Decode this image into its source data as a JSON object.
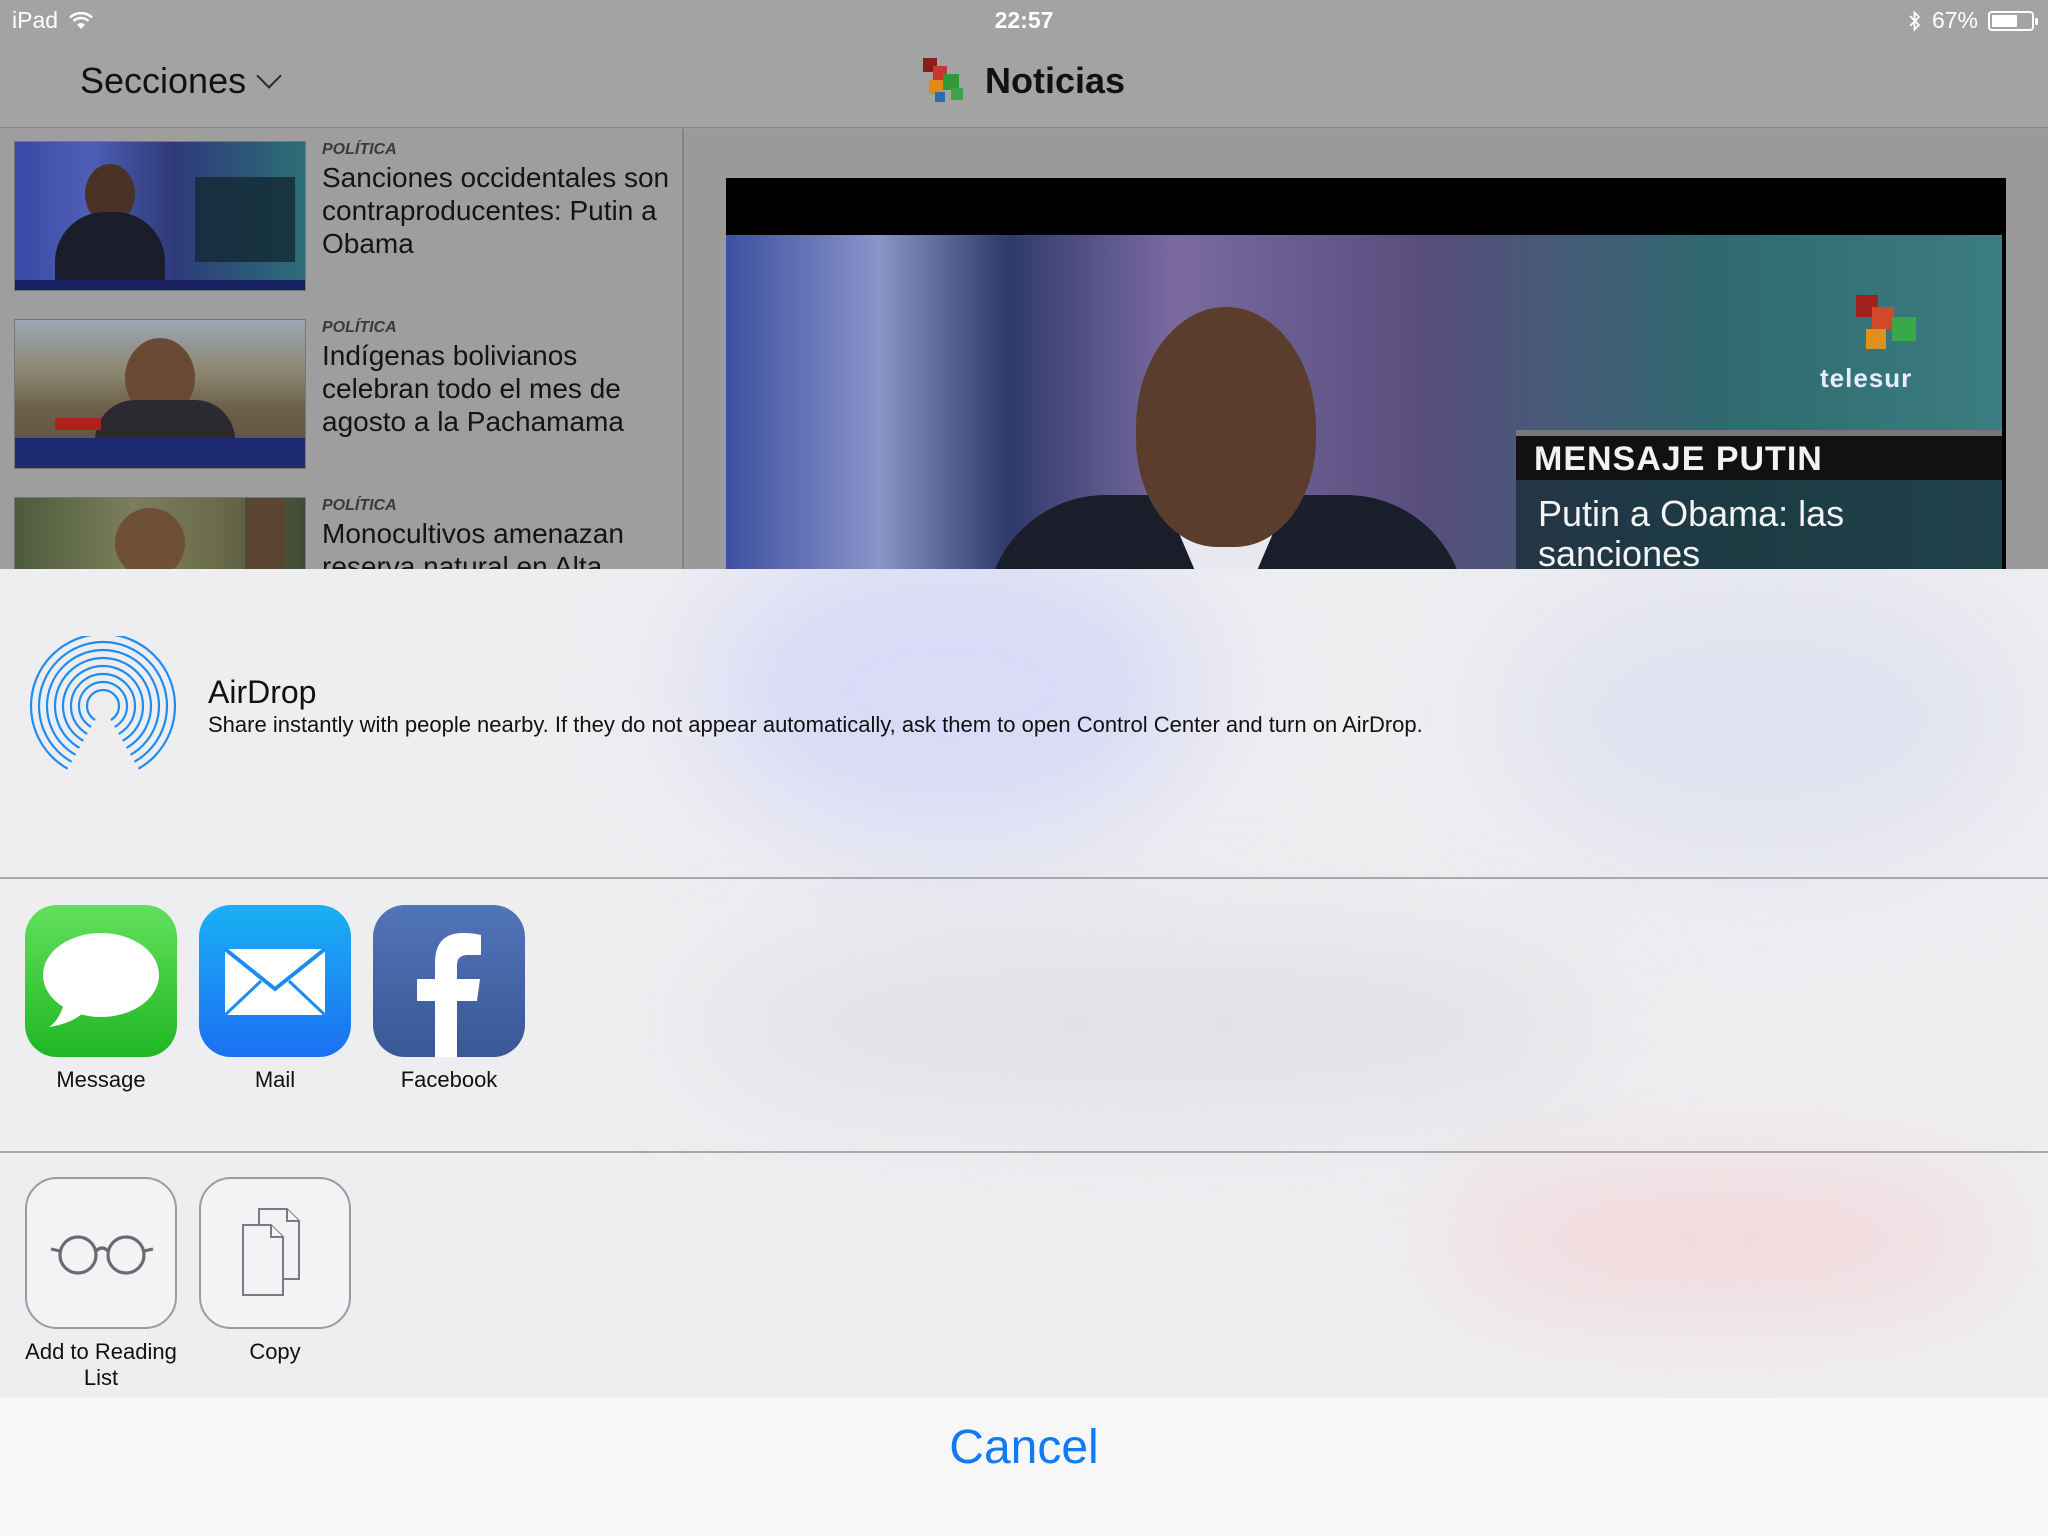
{
  "status_bar": {
    "device": "iPad",
    "time": "22:57",
    "battery": "67%",
    "battery_level": 0.67
  },
  "nav": {
    "sections_label": "Secciones",
    "title": "Noticias"
  },
  "news": [
    {
      "category": "POLÍTICA",
      "title": "Sanciones occidentales son contraproducentes: Putin a Obama"
    },
    {
      "category": "POLÍTICA",
      "title": "Indígenas bolivianos celebran todo el mes de agosto a la Pachamama"
    },
    {
      "category": "POLÍTICA",
      "title": "Monocultivos amenazan reserva natural en Alta"
    }
  ],
  "video": {
    "channel": "telesur",
    "banner_title": "MENSAJE PUTIN",
    "banner_text": "Putin a Obama: las sanciones"
  },
  "share_sheet": {
    "airdrop_title": "AirDrop",
    "airdrop_description": "Share instantly with people nearby. If they do not appear automatically, ask them to open Control Center and turn on AirDrop.",
    "apps": [
      {
        "label": "Message",
        "icon": "message-icon"
      },
      {
        "label": "Mail",
        "icon": "mail-icon"
      },
      {
        "label": "Facebook",
        "icon": "facebook-icon"
      }
    ],
    "actions": [
      {
        "label": "Add to Reading List",
        "icon": "glasses-icon"
      },
      {
        "label": "Copy",
        "icon": "copy-icon"
      }
    ],
    "cancel_label": "Cancel"
  },
  "colors": {
    "accent": "#1479f5",
    "message_green": "#1fb623",
    "mail_blue": "#1b6ff2",
    "facebook_blue": "#3a5796"
  }
}
